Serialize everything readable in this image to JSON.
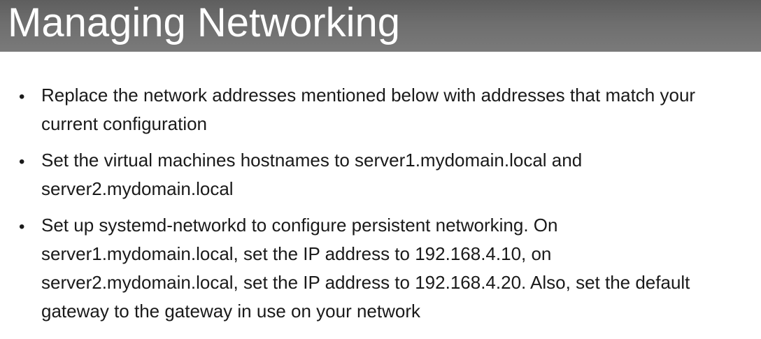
{
  "slide": {
    "title": "Managing Networking",
    "bullets": [
      {
        "text": "Replace the network addresses mentioned below with addresses that match your current configuration"
      },
      {
        "text": "Set the virtual machines hostnames to server1.mydomain.local and server2.mydomain.local"
      },
      {
        "text": "Set up systemd-networkd to configure persistent networking. On server1.mydomain.local, set the IP address to 192.168.4.10, on server2.mydomain.local, set the IP address  to 192.168.4.20. Also, set the default gateway to the gateway in use on your network"
      }
    ],
    "bullet_glyph": "•"
  },
  "colors": {
    "title_bar": "#6e6e6e",
    "title_text": "#ffffff",
    "body_text": "#1a1a1a",
    "background": "#ffffff"
  }
}
